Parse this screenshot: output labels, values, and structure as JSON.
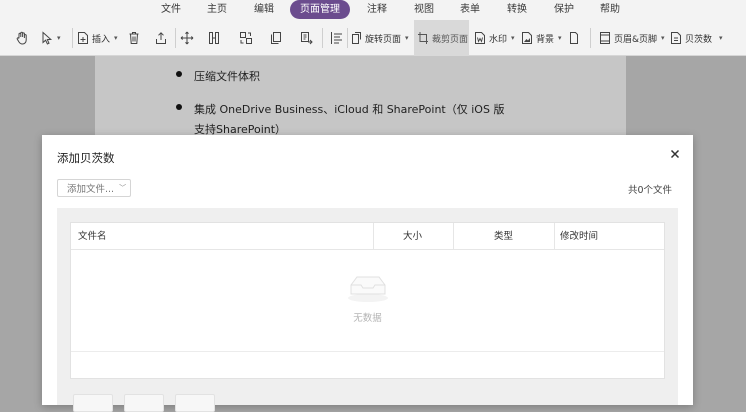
{
  "menu": {
    "tabs": [
      "文件",
      "主页",
      "编辑",
      "页面管理",
      "注释",
      "视图",
      "表单",
      "转换",
      "保护",
      "帮助"
    ],
    "active_tab": "页面管理",
    "active_color": "#6b4c8e"
  },
  "toolbar": {
    "insert_label": "插入",
    "rotate_label": "旋转页面",
    "crop_label": "裁剪页面",
    "watermark_label": "水印",
    "background_label": "背景",
    "header_footer_label": "页眉&页脚",
    "bates_label": "贝茨数",
    "icons": [
      "hand-icon",
      "select-arrow-icon",
      "insert-page-icon",
      "delete-icon",
      "extract-icon",
      "move-icon",
      "split-icon",
      "replace-icon",
      "duplicate-icon",
      "reorder-icon",
      "align-icon",
      "rotate-page-icon",
      "crop-page-icon",
      "watermark-icon",
      "background-icon",
      "header-footer-icon",
      "bates-icon"
    ]
  },
  "document": {
    "bullets": [
      {
        "line1": "压缩文件体积",
        "line2": ""
      },
      {
        "line1": "集成 OneDrive Business、iCloud 和 SharePoint（仅 iOS 版",
        "line2": "支持SharePoint）"
      }
    ]
  },
  "dialog": {
    "title": "添加贝茨数",
    "add_files_label": "添加文件...",
    "file_count": "共0个文件",
    "columns": [
      "文件名",
      "大小",
      "类型",
      "修改时间"
    ],
    "empty_text": "无数据",
    "close_icon": "close-icon"
  }
}
